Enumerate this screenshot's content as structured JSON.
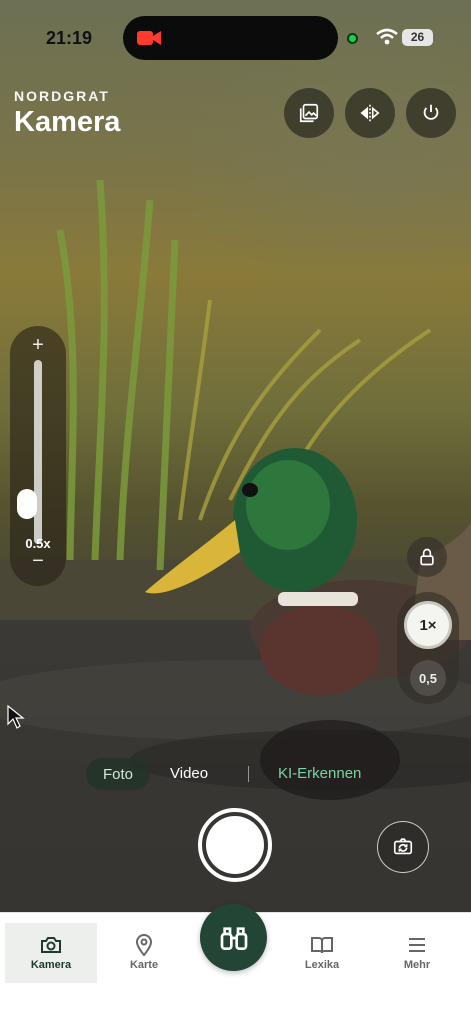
{
  "status_bar": {
    "time": "21:19",
    "battery": "26"
  },
  "header": {
    "brand": "NORDGRAT",
    "title": "Kamera"
  },
  "top_actions": {
    "gallery_icon": "gallery-icon",
    "mirror_icon": "mirror-icon",
    "power_icon": "power-icon"
  },
  "zoom": {
    "plus": "+",
    "minus": "−",
    "value": "0.5x",
    "level": 0.15
  },
  "lens": {
    "active": "1×",
    "secondary": "0,5"
  },
  "modes": {
    "foto": "Foto",
    "video": "Video",
    "ki": "KI-Erkennen"
  },
  "bottom_nav": {
    "items": [
      {
        "label": "Kamera",
        "icon": "camera-icon"
      },
      {
        "label": "Karte",
        "icon": "map-pin-icon"
      },
      {
        "label": "Lexika",
        "icon": "book-icon"
      },
      {
        "label": "Mehr",
        "icon": "menu-icon"
      }
    ],
    "center_icon": "binoculars-icon"
  },
  "colors": {
    "accent": "#234536",
    "mode_ki": "#7dd3a3"
  }
}
